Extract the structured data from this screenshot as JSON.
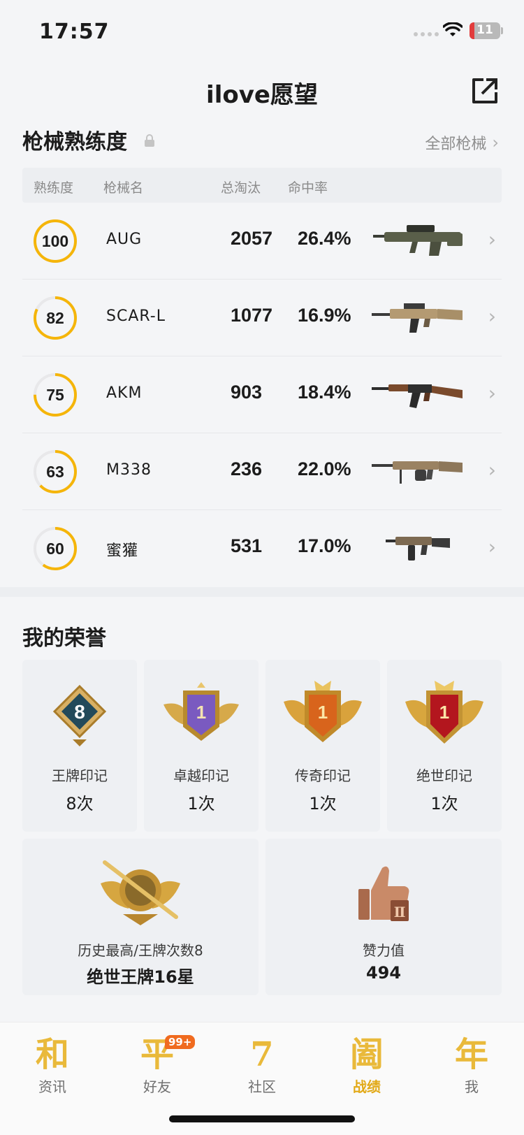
{
  "status": {
    "time": "17:57",
    "battery": "11"
  },
  "header": {
    "title": "ilove愿望"
  },
  "weapons": {
    "title": "枪械熟练度",
    "all_link": "全部枪械",
    "columns": {
      "proficiency": "熟练度",
      "name": "枪械名",
      "kills": "总淘汰",
      "hit_rate": "命中率"
    },
    "rows": [
      {
        "proficiency": "100",
        "name": "AUG",
        "kills": "2057",
        "hit_rate": "26.4%",
        "image": "bullpup-rifle-icon"
      },
      {
        "proficiency": "82",
        "name": "SCAR-L",
        "kills": "1077",
        "hit_rate": "16.9%",
        "image": "tan-rifle-icon"
      },
      {
        "proficiency": "75",
        "name": "AKM",
        "kills": "903",
        "hit_rate": "18.4%",
        "image": "wood-rifle-icon"
      },
      {
        "proficiency": "63",
        "name": "M338",
        "kills": "236",
        "hit_rate": "22.0%",
        "image": "machine-gun-icon"
      },
      {
        "proficiency": "60",
        "name": "蜜獾",
        "kills": "531",
        "hit_rate": "17.0%",
        "image": "compact-rifle-icon"
      }
    ]
  },
  "honors": {
    "title": "我的荣誉",
    "marks": [
      {
        "label": "王牌印记",
        "value": "8次",
        "emblem_text": "8"
      },
      {
        "label": "卓越印记",
        "value": "1次",
        "emblem_text": "1"
      },
      {
        "label": "传奇印记",
        "value": "1次",
        "emblem_text": "1"
      },
      {
        "label": "绝世印记",
        "value": "1次",
        "emblem_text": "1"
      }
    ],
    "rank": {
      "label": "历史最高/王牌次数8",
      "value": "绝世王牌16星"
    },
    "likes": {
      "label": "赞力值",
      "value": "494"
    }
  },
  "tabs": [
    {
      "glyph": "和",
      "label": "资讯"
    },
    {
      "glyph": "平",
      "label": "好友",
      "badge": "99+"
    },
    {
      "glyph": "7",
      "label": "社区"
    },
    {
      "glyph": "阖",
      "label": "战绩",
      "active": true
    },
    {
      "glyph": "年",
      "label": "我"
    }
  ],
  "colors": {
    "accent": "#f5b50a",
    "ring_track": "#e8e8ea",
    "tab_gold": "#e9b93a",
    "badge": "#f06b1f"
  }
}
